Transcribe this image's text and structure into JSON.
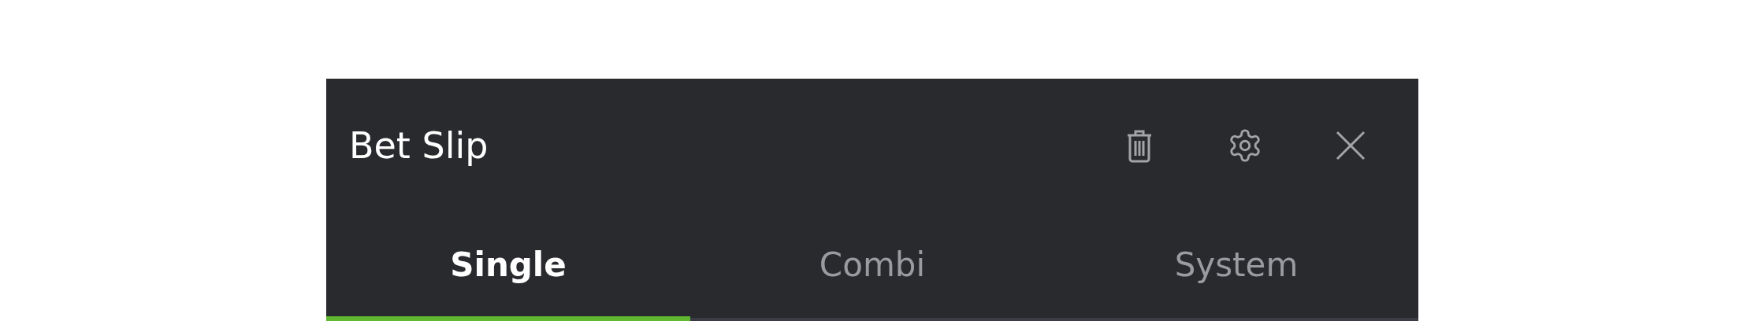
{
  "header": {
    "title": "Bet Slip"
  },
  "tabs": [
    {
      "label": "Single",
      "selected": true
    },
    {
      "label": "Combi",
      "selected": false
    },
    {
      "label": "System",
      "selected": false
    }
  ]
}
